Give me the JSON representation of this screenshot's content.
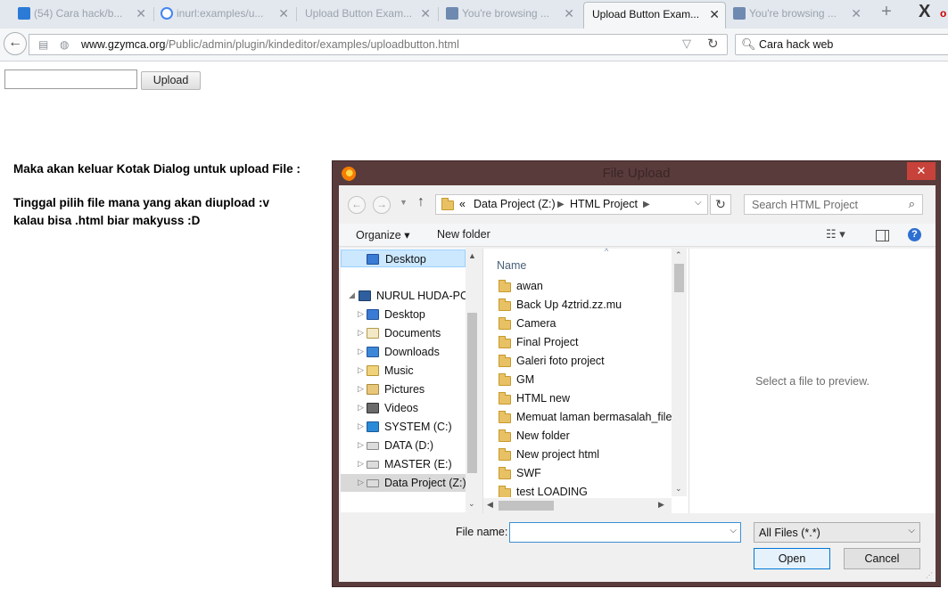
{
  "browser": {
    "tabs": [
      {
        "title": "(54) Cara hack/b...",
        "icon": "facebook-like-icon",
        "color": "#2b7bd6"
      },
      {
        "title": "inurl:examples/u...",
        "icon": "google-icon",
        "color": "#4285f4"
      },
      {
        "title": "Upload Button Exam...",
        "icon": "page-icon",
        "color": "#cccccc"
      },
      {
        "title": "You're browsing ...",
        "icon": "browse-icon",
        "color": "#6f8ab0"
      },
      {
        "title": "Upload Button Exam...",
        "icon": "page-icon",
        "color": "#cccccc",
        "active": true
      },
      {
        "title": "You're browsing ...",
        "icon": "browse-icon",
        "color": "#6f8ab0"
      }
    ],
    "new_tab": "+",
    "close_window": "X",
    "close_tab": "✕",
    "url": {
      "host": "www.gzymca.org",
      "path": "/Public/admin/plugin/kindeditor/examples/uploadbutton.html"
    },
    "search_value": "Cara hack web"
  },
  "page": {
    "upload_button": "Upload",
    "text_line1": "Maka akan keluar Kotak Dialog untuk upload File :",
    "text_line2": "Tinggal pilih file mana yang akan diupload :v",
    "text_line3": "kalau bisa .html biar makyuss :D"
  },
  "dialog": {
    "title": "File Upload",
    "close": "✕",
    "breadcrumb": {
      "prefix": "«",
      "items": [
        "Data Project (Z:)",
        "HTML Project"
      ]
    },
    "search_placeholder": "Search HTML Project",
    "toolbar": {
      "organize": "Organize ▾",
      "new_folder": "New folder",
      "view": "☷ ▾",
      "help": "?"
    },
    "nav": {
      "desktop_top": "Desktop",
      "computer": "NURUL HUDA-PC",
      "items": [
        {
          "label": "Desktop",
          "icon": "desktop-icon"
        },
        {
          "label": "Documents",
          "icon": "documents-icon"
        },
        {
          "label": "Downloads",
          "icon": "downloads-icon"
        },
        {
          "label": "Music",
          "icon": "music-icon"
        },
        {
          "label": "Pictures",
          "icon": "pictures-icon"
        },
        {
          "label": "Videos",
          "icon": "videos-icon"
        },
        {
          "label": "SYSTEM (C:)",
          "icon": "system-drive-icon"
        },
        {
          "label": "DATA (D:)",
          "icon": "drive-icon"
        },
        {
          "label": "MASTER (E:)",
          "icon": "drive-icon"
        },
        {
          "label": "Data Project (Z:)",
          "icon": "drive-icon",
          "selected": true
        }
      ]
    },
    "column_header": "Name",
    "files": [
      "awan",
      "Back Up 4ztrid.zz.mu",
      "Camera",
      "Final Project",
      "Galeri foto project",
      "GM",
      "HTML new",
      "Memuat laman bermasalah_files",
      "New folder",
      "New project html",
      "SWF",
      "test LOADING"
    ],
    "preview_message": "Select a file to preview.",
    "filename_label": "File name:",
    "filename_value": "",
    "filetype": "All Files (*.*)",
    "open_button": "Open",
    "cancel_button": "Cancel"
  },
  "colors": {
    "dialog_frame": "#5a3b3b",
    "close_red": "#c7423a",
    "selection": "#cce8ff",
    "folder": "#e8c164"
  }
}
